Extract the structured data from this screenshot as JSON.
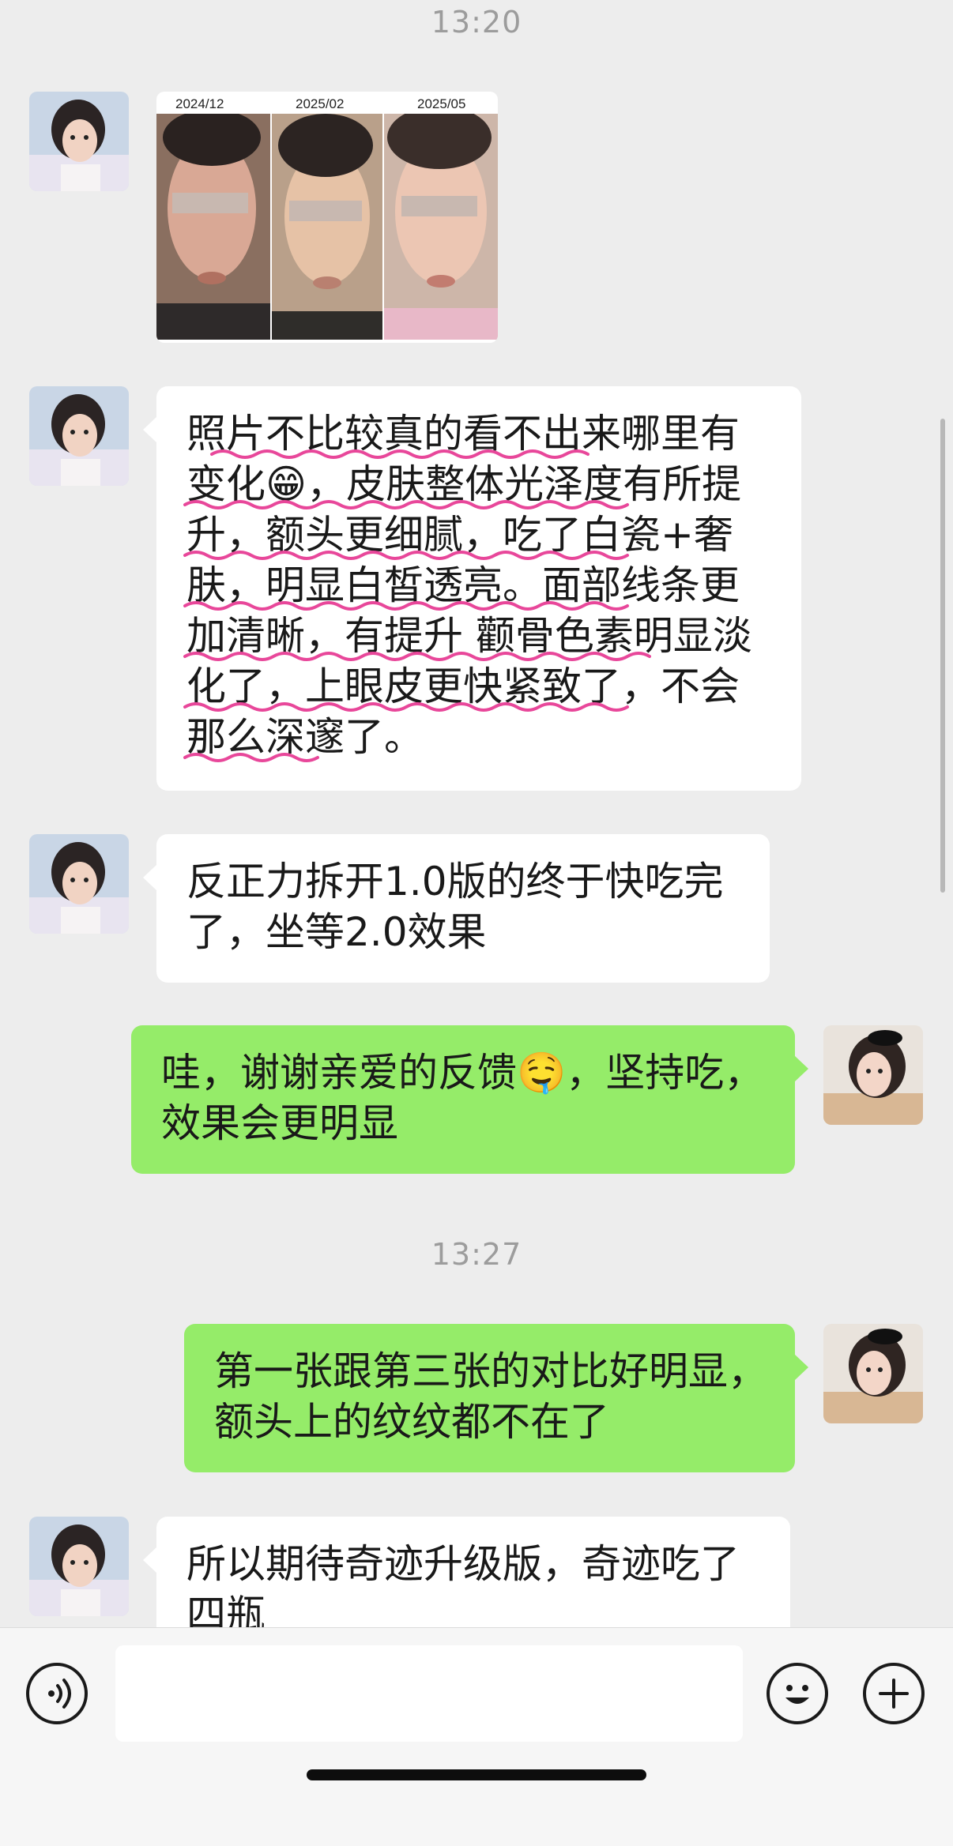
{
  "messages": {
    "time1": "13:20",
    "photo_labels": [
      "2024/12",
      "2025/02",
      "2025/05"
    ],
    "msg1_lines": [
      "照片不比较真的看不出来哪里有",
      "变化😁，皮肤整体光泽度有所提",
      "升，额头更细腻，吃了白瓷+奢",
      "肤，明显白皙透亮。面部线条更",
      "加清晰，有提升 颧骨色素明显淡",
      "化了，上眼皮更快紧致了，不会",
      "那么深邃了。"
    ],
    "msg2_lines": [
      "反正力拆开1.0版的终于快吃完",
      "了，坐等2.0效果"
    ],
    "reply1_lines": [
      "哇，谢谢亲爱的反馈🤤，坚持吃，",
      "效果会更明显"
    ],
    "time2": "13:27",
    "reply2_lines": [
      "第一张跟第三张的对比好明显，",
      "额头上的纹纹都不在了"
    ],
    "msg3_lines": [
      "所以期待奇迹升级版，奇迹吃了",
      "四瓶"
    ]
  },
  "input": {
    "placeholder": ""
  },
  "colors": {
    "background": "#ededed",
    "incoming_bubble": "#ffffff",
    "outgoing_bubble": "#95ec69",
    "highlight_underline": "#e8479a"
  },
  "icons": {
    "voice": "voice-icon",
    "emoji": "emoji-icon",
    "plus": "plus-icon"
  }
}
